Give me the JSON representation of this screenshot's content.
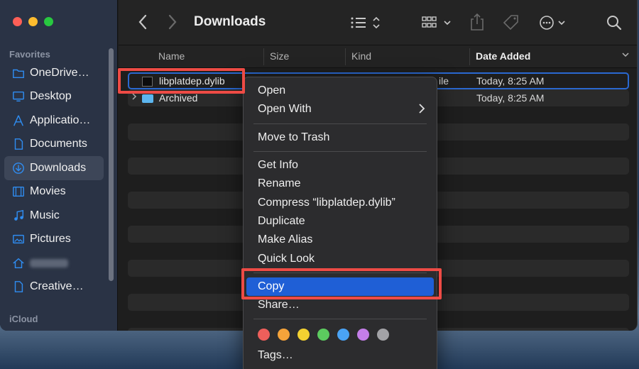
{
  "window": {
    "title": "Downloads"
  },
  "sidebar": {
    "favorites_title": "Favorites",
    "icloud_title": "iCloud",
    "items": [
      {
        "label": "OneDrive…",
        "icon": "cloud-folder-icon"
      },
      {
        "label": "Desktop",
        "icon": "desktop-icon"
      },
      {
        "label": "Applicatio…",
        "icon": "applications-icon"
      },
      {
        "label": "Documents",
        "icon": "document-icon"
      },
      {
        "label": "Downloads",
        "icon": "downloads-icon",
        "active": true
      },
      {
        "label": "Movies",
        "icon": "film-icon"
      },
      {
        "label": "Music",
        "icon": "music-note-icon"
      },
      {
        "label": "Pictures",
        "icon": "picture-icon"
      },
      {
        "label": "",
        "icon": "home-icon",
        "blurred": true
      },
      {
        "label": "Creative…",
        "icon": "document-icon"
      }
    ]
  },
  "columns": {
    "name": "Name",
    "size": "Size",
    "kind": "Kind",
    "date_added": "Date Added"
  },
  "files": [
    {
      "name": "libplatdep.dylib",
      "kind_fragment": "ile",
      "date": "Today, 8:25 AM"
    },
    {
      "name": "Archived",
      "date": "Today, 8:25 AM"
    }
  ],
  "context_menu": {
    "open": "Open",
    "open_with": "Open With",
    "move_to_trash": "Move to Trash",
    "get_info": "Get Info",
    "rename": "Rename",
    "compress": "Compress “libplatdep.dylib”",
    "duplicate": "Duplicate",
    "make_alias": "Make Alias",
    "quick_look": "Quick Look",
    "copy": "Copy",
    "share": "Share…",
    "tags": "Tags…",
    "tag_colors": [
      "#ee5f5b",
      "#f5a33a",
      "#f3d131",
      "#5ccb5f",
      "#4aa3f5",
      "#c47ee8",
      "#a2a2a6"
    ]
  },
  "colors": {
    "accent": "#1f5fd6",
    "annotation": "#ee4b45"
  }
}
